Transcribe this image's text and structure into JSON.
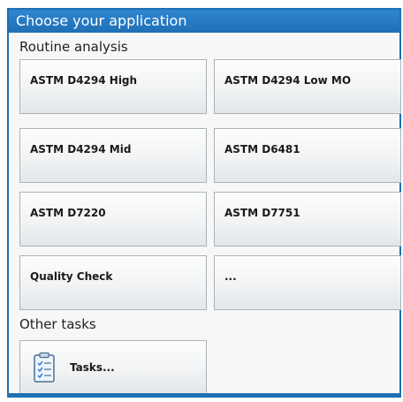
{
  "window": {
    "title": "Choose your application"
  },
  "routine": {
    "label": "Routine analysis",
    "items": [
      {
        "label": "ASTM D4294 High"
      },
      {
        "label": "ASTM D4294 Low MO"
      },
      {
        "label": "ASTM D4294 Mid"
      },
      {
        "label": "ASTM D6481"
      },
      {
        "label": "ASTM D7220"
      },
      {
        "label": "ASTM D7751"
      },
      {
        "label": "Quality Check"
      },
      {
        "label": "..."
      }
    ]
  },
  "other": {
    "label": "Other tasks",
    "tasks_button": {
      "label": "Tasks...",
      "icon": "checklist-icon"
    }
  },
  "colors": {
    "accent": "#1f6fb5",
    "tile_border": "#a9b3ba"
  }
}
